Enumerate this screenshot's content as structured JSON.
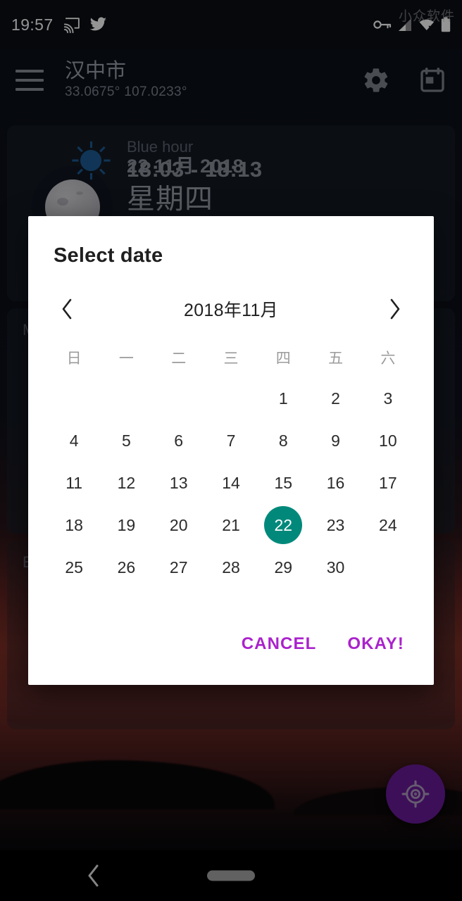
{
  "status_bar": {
    "time": "19:57",
    "left_icons": [
      "cast-icon",
      "twitter-icon"
    ],
    "right_icons": [
      "vpn-key-icon",
      "cellular-signal-icon",
      "wifi-off-icon",
      "battery-icon"
    ],
    "watermark": "小众软件"
  },
  "app_bar": {
    "menu_icon": "hamburger-menu-icon",
    "city": "汉中市",
    "coords": "33.0675°  107.0233°",
    "settings_icon": "gear-icon",
    "calendar_icon": "calendar-icon"
  },
  "background": {
    "moon_card": {
      "date": "22 11月 2018",
      "weekday": "星期四",
      "moon_icon": "moon-phase-icon"
    },
    "mid_card_label": "M",
    "events_card_label": "EV",
    "blue_hour": {
      "title": "Blue hour",
      "time_range": "18:03 - 18:13",
      "icon": "blue-hour-sun-icon"
    },
    "fab_icon": "my-location-icon",
    "fab_color": "#6a1b9a"
  },
  "nav_bar": {
    "back_icon": "back-chevron-icon",
    "home_indicator": "home-pill-indicator"
  },
  "dialog": {
    "title": "Select date",
    "prev_icon": "chevron-left-icon",
    "next_icon": "chevron-right-icon",
    "month_label": "2018年11月",
    "weekdays": [
      "日",
      "一",
      "二",
      "三",
      "四",
      "五",
      "六"
    ],
    "leading_blanks": 4,
    "days": [
      1,
      2,
      3,
      4,
      5,
      6,
      7,
      8,
      9,
      10,
      11,
      12,
      13,
      14,
      15,
      16,
      17,
      18,
      19,
      20,
      21,
      22,
      23,
      24,
      25,
      26,
      27,
      28,
      29,
      30
    ],
    "selected_day": 22,
    "accent_color": "#00897b",
    "cancel_label": "CANCEL",
    "okay_label": "OKAY!",
    "action_color": "#aa22cc"
  }
}
